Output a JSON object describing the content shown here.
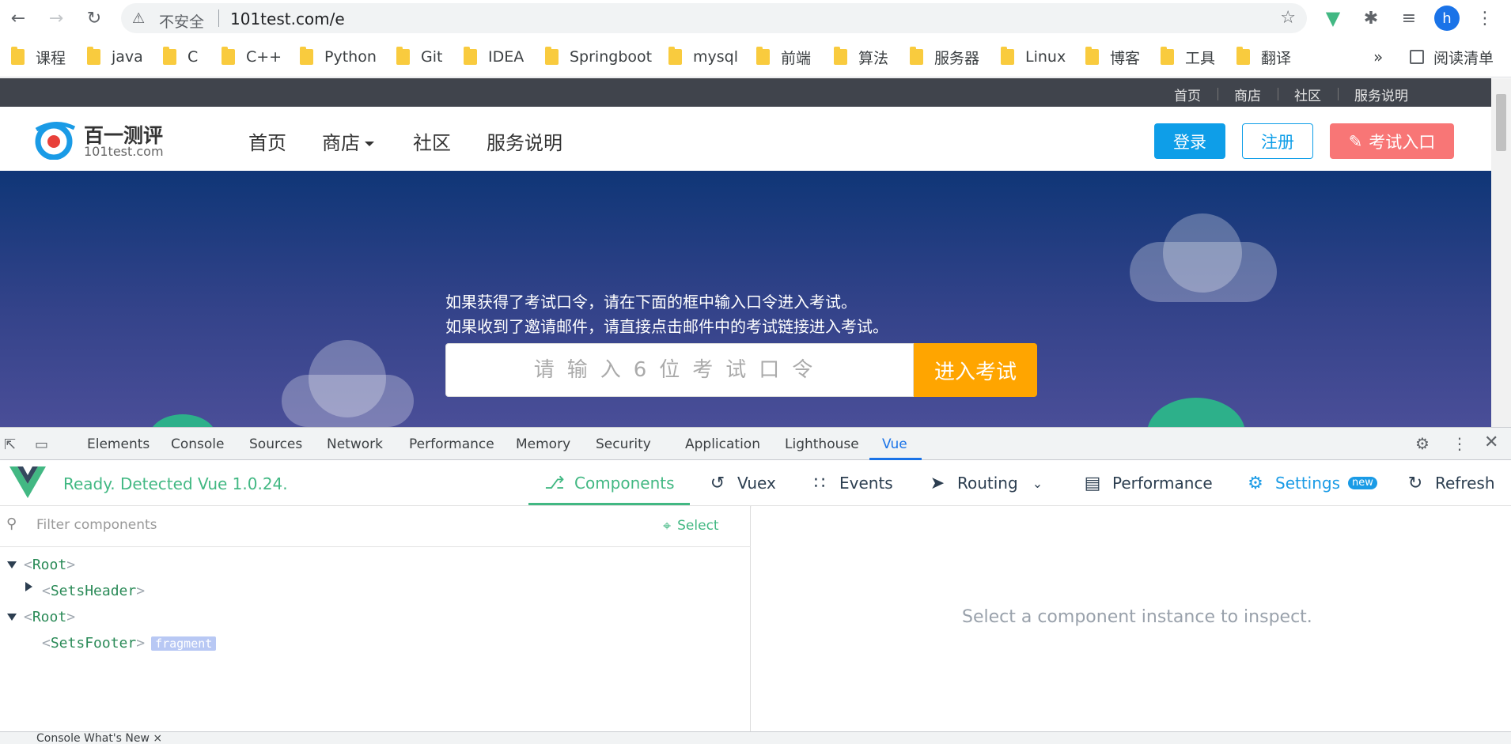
{
  "browser": {
    "insecure_label": "不安全",
    "url": "101test.com/e",
    "avatar_letter": "h",
    "bookmarks": [
      "课程",
      "java",
      "C",
      "C++",
      "Python",
      "Git",
      "IDEA",
      "Springboot",
      "mysql",
      "前端",
      "算法",
      "服务器",
      "Linux",
      "博客",
      "工具",
      "翻译"
    ],
    "more": "»",
    "reading_list": "阅读清单"
  },
  "site": {
    "top_links": [
      "首页",
      "商店",
      "社区",
      "服务说明"
    ],
    "logo_text": "百一测评",
    "logo_sub": "101test.com",
    "nav": [
      "首页",
      "商店",
      "社区",
      "服务说明"
    ],
    "login": "登录",
    "register": "注册",
    "exam_entry": "考试入口",
    "hero_line1": "如果获得了考试口令，请在下面的框中输入口令进入考试。",
    "hero_line2": "如果收到了邀请邮件，请直接点击邮件中的考试链接进入考试。",
    "code_placeholder": "请输入6位考试口令",
    "enter_exam": "进入考试"
  },
  "devtools": {
    "tabs": [
      "Elements",
      "Console",
      "Sources",
      "Network",
      "Performance",
      "Memory",
      "Security",
      "Application",
      "Lighthouse",
      "Vue"
    ],
    "active_tab": "Vue",
    "vue_status": "Ready. Detected Vue 1.0.24.",
    "vue_tabs": [
      "Components",
      "Vuex",
      "Events",
      "Routing",
      "Performance",
      "Settings",
      "Refresh"
    ],
    "settings_badge": "new",
    "filter_placeholder": "Filter components",
    "select_label": "Select",
    "tree": [
      {
        "name": "Root",
        "expanded": true
      },
      {
        "name": "SetsHeader",
        "expanded": false
      },
      {
        "name": "Root",
        "expanded": true
      },
      {
        "name": "SetsFooter",
        "badge": "fragment"
      }
    ],
    "inspect_hint": "Select a component instance to inspect.",
    "bottom_hint": "Console  What's New  ×"
  },
  "colors": {
    "vue_green": "#42b883",
    "login_bg": "#0e9ee8",
    "exam_bg": "#f87676",
    "enter_bg": "#ffa500",
    "hero_top": "#0f3677"
  }
}
